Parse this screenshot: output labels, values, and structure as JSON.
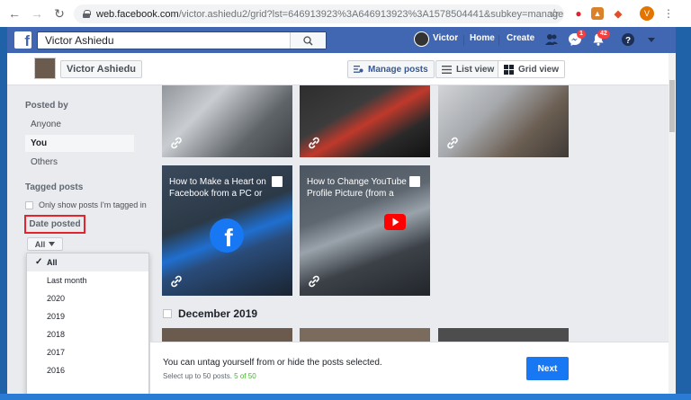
{
  "browser": {
    "url_host": "web.facebook.com",
    "url_path": "/victor.ashiedu2/grid?lst=646913923%3A646913923%3A1578504441&subkey=manage",
    "profile_initial": "V"
  },
  "fb": {
    "search_value": "Victor Ashiedu",
    "user_name": "Victor",
    "home_label": "Home",
    "create_label": "Create",
    "messages_badge": "1",
    "notifications_badge": "42",
    "brand_color": "#4267b2"
  },
  "profile": {
    "name": "Victor Ashiedu",
    "manage_posts_label": "Manage posts",
    "list_view_label": "List view",
    "grid_view_label": "Grid view"
  },
  "filters": {
    "posted_by_heading": "Posted by",
    "posted_by_options": [
      "Anyone",
      "You",
      "Others"
    ],
    "tagged_heading": "Tagged posts",
    "tagged_checkbox_label": "Only show posts I'm tagged in",
    "date_posted_heading": "Date posted",
    "date_selected": "All",
    "date_options": [
      "All",
      "Last month",
      "2020",
      "2019",
      "2018",
      "2017",
      "2016"
    ]
  },
  "posts": [
    {
      "title": "How to Make a Heart on Facebook from a PC or"
    },
    {
      "title": "How to Change YouTube Profile Picture (from a PC"
    }
  ],
  "section": {
    "month_heading": "December 2019"
  },
  "bottom_panel": {
    "message": "You can untag yourself from or hide the posts selected.",
    "sub_text": "Select up to 50 posts.",
    "count_text": "5 of 50",
    "next_label": "Next"
  }
}
